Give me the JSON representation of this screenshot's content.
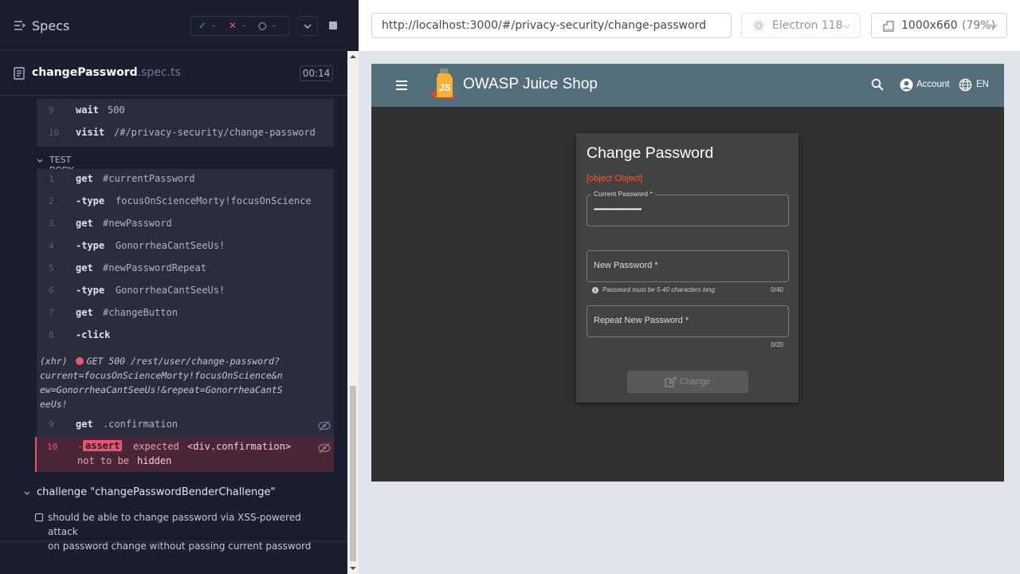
{
  "reporter": {
    "title": "Specs",
    "stats": {
      "passed": "✓",
      "failed": "✕",
      "pending": "○",
      "dash": "–"
    },
    "spec_file": {
      "name": "changePassword",
      "ext": ".spec.ts",
      "duration": "00:14"
    },
    "before_commands": [
      {
        "num": "9",
        "name": "wait",
        "arg": "500"
      },
      {
        "num": "10",
        "name": "visit",
        "arg": "/#/privacy-security/change-password"
      }
    ],
    "section_label": "TEST BODY",
    "commands": [
      {
        "num": "1",
        "name": "get",
        "arg": "#currentPassword"
      },
      {
        "num": "2",
        "name": "-type",
        "arg": "focusOnScienceMorty!focusOnScience"
      },
      {
        "num": "3",
        "name": "get",
        "arg": "#newPassword"
      },
      {
        "num": "4",
        "name": "-type",
        "arg": "GonorrheaCantSeeUs!"
      },
      {
        "num": "5",
        "name": "get",
        "arg": "#newPasswordRepeat"
      },
      {
        "num": "6",
        "name": "-type",
        "arg": "GonorrheaCantSeeUs!"
      },
      {
        "num": "7",
        "name": "get",
        "arg": "#changeButton"
      },
      {
        "num": "8",
        "name": "-click",
        "arg": ""
      }
    ],
    "xhr": {
      "label": "(xhr)",
      "line1": "GET 500 /rest/user/change-password?",
      "line2": "current=focusOnScienceMorty!focusOnScience&n",
      "line3": "ew=GonorrheaCantSeeUs!&repeat=GonorrheaCantS",
      "line4": "eeUs!"
    },
    "get_confirmation": {
      "num": "9",
      "name": "get",
      "arg": ".confirmation"
    },
    "assertion": {
      "num": "10",
      "dash": "-",
      "tag": "assert",
      "word_expected": "expected",
      "subject": "<div.confirmation>",
      "word_not": "not to be",
      "state": "hidden"
    },
    "challenge": "challenge \"changePasswordBenderChallenge\"",
    "test_line1": "should be able to change password via XSS-powered attack",
    "test_line2": "on password change without passing current password"
  },
  "aut": {
    "url": "http://localhost:3000/#/privacy-security/change-password",
    "browser": "Electron 118",
    "viewport": "1000x660",
    "zoom": "(79%)"
  },
  "app": {
    "title": "OWASP Juice Shop",
    "account_label": "Account",
    "language": "EN",
    "card_title": "Change Password",
    "error": "[object Object]",
    "current_password_label": "Current Password *",
    "current_password_value": "•••••••••••••••••••••••••••••••••",
    "new_password_placeholder": "New Password *",
    "hint": "Password must be 5-40 characters long.",
    "new_count": "0/40",
    "repeat_placeholder": "Repeat New Password *",
    "repeat_count": "0/20",
    "change_button": "Change"
  },
  "colors": {
    "reporter_bg": "#1b1e2e",
    "command_bg": "#2a2d3e",
    "failed": "#e45770",
    "toolbar": "#546e7a",
    "app_bg": "#303030",
    "card_bg": "#424242",
    "error": "#ff5722"
  }
}
